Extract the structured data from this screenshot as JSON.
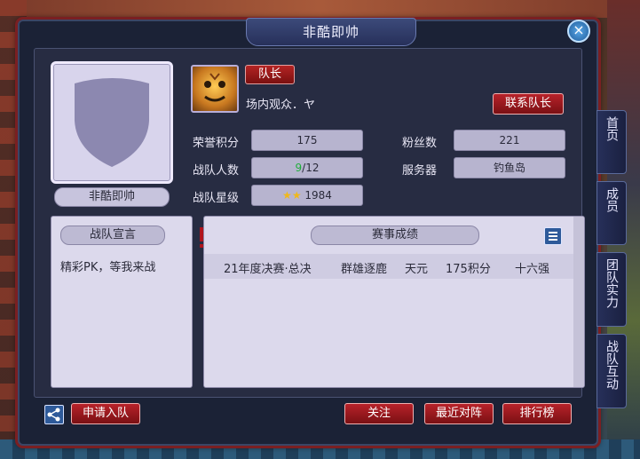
{
  "window": {
    "title": "非酷即帅",
    "close_label": "×"
  },
  "profile": {
    "team_name": "非酷即帅"
  },
  "leader": {
    "badge": "队长",
    "name": "场内观众．ヤ",
    "contact_button": "联系队长"
  },
  "stats": {
    "honor_points": {
      "label": "荣誉积分",
      "value": "175"
    },
    "fans": {
      "label": "粉丝数",
      "value": "221"
    },
    "members": {
      "label": "战队人数",
      "current": "9",
      "max": "/12"
    },
    "server": {
      "label": "服务器",
      "value": "钓鱼岛"
    },
    "star_level": {
      "label": "战队星级",
      "value": "1984",
      "stars": 2
    }
  },
  "declaration": {
    "header": "战队宣言",
    "text": "精彩PK，等我来战"
  },
  "results": {
    "header": "赛事成绩",
    "rows": [
      {
        "event": "21年度决赛·总决",
        "name": "群雄逐鹿",
        "tier": "天元",
        "points": "175积分",
        "rank": "十六强"
      }
    ]
  },
  "footer": {
    "apply_button": "申请入队",
    "follow_button": "关注",
    "recent_button": "最近对阵",
    "ranking_button": "排行榜"
  },
  "side_tabs": [
    "首页",
    "成员",
    "团队实力",
    "战队互动"
  ],
  "colors": {
    "accent_red": "#b8222a",
    "frame_blue": "#27305a"
  }
}
